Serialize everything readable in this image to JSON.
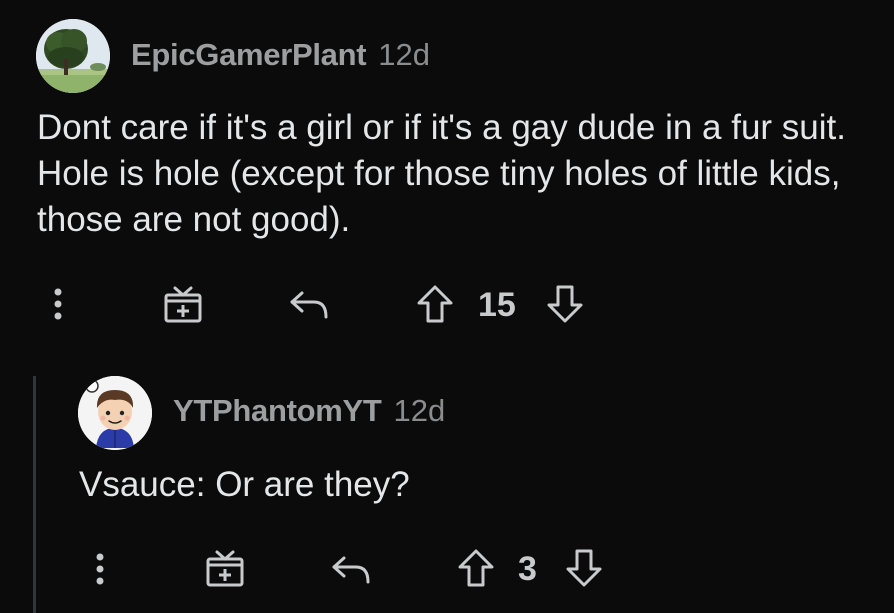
{
  "comments": [
    {
      "author": "EpicGamerPlant",
      "time": "12d",
      "body": "Dont care if it's a girl or if it's a gay dude in a fur suit. Hole is hole (except for those tiny holes of little kids, those are not good).",
      "score": "15",
      "avatar_icon": "tree-avatar-icon"
    },
    {
      "author": "YTPhantomYT",
      "time": "12d",
      "body": "Vsauce: Or are they?",
      "score": "3",
      "avatar_icon": "cartoon-boy-avatar-icon"
    }
  ],
  "icons": {
    "more": "vertical-ellipsis-icon",
    "award": "gift-box-icon",
    "reply": "reply-arrow-icon",
    "upvote": "arrow-up-icon",
    "downvote": "arrow-down-icon"
  },
  "colors": {
    "background": "#0b0b0b",
    "text": "#e4e6e8",
    "meta": "#9c9ea0",
    "icon": "#c8cacc",
    "thread_line": "#343536"
  }
}
